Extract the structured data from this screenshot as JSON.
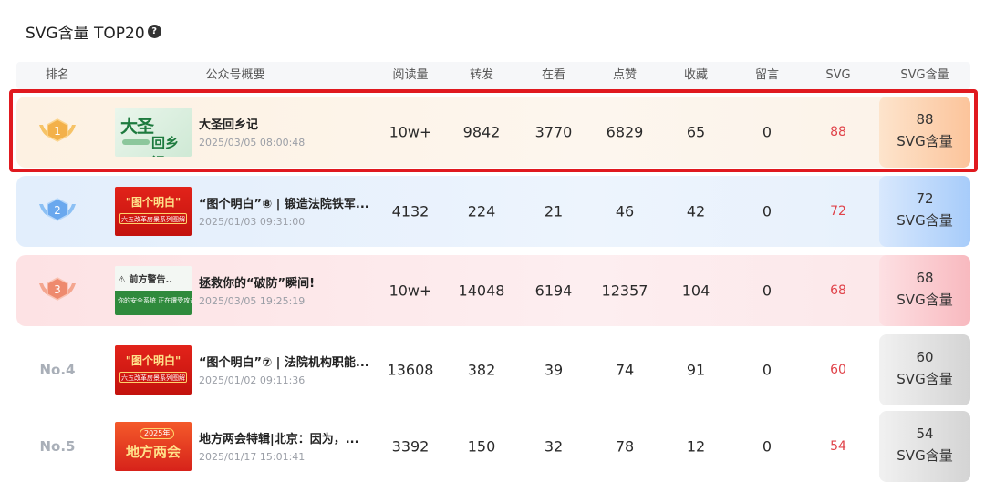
{
  "section": {
    "title": "SVG含量 TOP20",
    "help_icon": "help-icon"
  },
  "columns": [
    "排名",
    "公众号概要",
    "阅读量",
    "转发",
    "在看",
    "点赞",
    "收藏",
    "留言",
    "SVG",
    "SVG含量"
  ],
  "colors": {
    "highlight_border": "#e0191f",
    "svg_value": "#e0434a",
    "gold": "#f3b14a",
    "silver_blue": "#6aa8ee",
    "bronze": "#ee8a6e"
  },
  "rows": [
    {
      "rank": "1",
      "rank_style": "gold-medal",
      "thumb": {
        "line1": "大圣",
        "line2": "回乡记"
      },
      "title": "大圣回乡记",
      "date": "2025/03/05 08:00:48",
      "read": "10w+",
      "share": "9842",
      "watch": "3770",
      "like": "6829",
      "fav": "65",
      "comment": "0",
      "svg": "88",
      "svg_badge_num": "88",
      "svg_badge_label": "SVG含量"
    },
    {
      "rank": "2",
      "rank_style": "silver-medal",
      "thumb": {
        "line1": "\"图个明白\"",
        "line2": "六五改革房景系列图解"
      },
      "title": "“图个明白”⑧ | 锻造法院铁军...",
      "date": "2025/01/03 09:31:00",
      "read": "4132",
      "share": "224",
      "watch": "21",
      "like": "46",
      "fav": "42",
      "comment": "0",
      "svg": "72",
      "svg_badge_num": "72",
      "svg_badge_label": "SVG含量"
    },
    {
      "rank": "3",
      "rank_style": "bronze-medal",
      "thumb": {
        "line1": "⚠ 前方警告..",
        "line2": "你的安全系统 正在遭受攻击"
      },
      "title": "拯救你的“破防”瞬间!",
      "date": "2025/03/05 19:25:19",
      "read": "10w+",
      "share": "14048",
      "watch": "6194",
      "like": "12357",
      "fav": "104",
      "comment": "0",
      "svg": "68",
      "svg_badge_num": "68",
      "svg_badge_label": "SVG含量"
    },
    {
      "rank": "No.4",
      "rank_style": "text",
      "thumb": {
        "line1": "\"图个明白\"",
        "line2": "六五改革房景系列图解"
      },
      "title": "“图个明白”⑦ | 法院机构职能...",
      "date": "2025/01/02 09:11:36",
      "read": "13608",
      "share": "382",
      "watch": "39",
      "like": "74",
      "fav": "91",
      "comment": "0",
      "svg": "60",
      "svg_badge_num": "60",
      "svg_badge_label": "SVG含量"
    },
    {
      "rank": "No.5",
      "rank_style": "text",
      "thumb": {
        "line1": "2025年",
        "line2": "地方两会"
      },
      "title": "地方两会特辑|北京：因为，...",
      "date": "2025/01/17 15:01:41",
      "read": "3392",
      "share": "150",
      "watch": "32",
      "like": "78",
      "fav": "12",
      "comment": "0",
      "svg": "54",
      "svg_badge_num": "54",
      "svg_badge_label": "SVG含量"
    }
  ]
}
